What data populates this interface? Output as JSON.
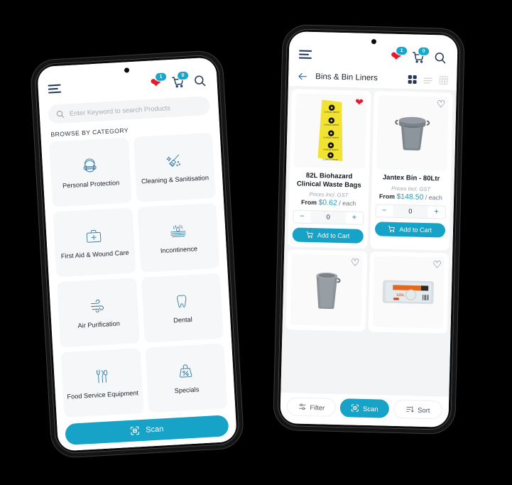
{
  "background_color": "#000000",
  "accent_color": "#16a3c7",
  "heart_color": "#e8192c",
  "navy_color": "#21365e",
  "left_phone": {
    "header": {
      "menu_icon": "hamburger-menu-icon",
      "wishlist_icon": "heart-icon",
      "wishlist_count": "1",
      "cart_icon": "cart-icon",
      "cart_count": "0",
      "search_icon": "search-icon"
    },
    "search": {
      "icon": "search-icon",
      "placeholder": "Enter Keyword to search Products",
      "value": ""
    },
    "section_title": "BROWSE BY CATEGORY",
    "categories": [
      {
        "label": "Personal Protection",
        "icon": "face-mask-icon"
      },
      {
        "label": "Cleaning & Sanitisation",
        "icon": "broom-sparkle-icon"
      },
      {
        "label": "First Aid & Wound Care",
        "icon": "first-aid-kit-icon"
      },
      {
        "label": "Incontinence",
        "icon": "absorbency-drops-icon"
      },
      {
        "label": "Air Purification",
        "icon": "air-flow-icon"
      },
      {
        "label": "Dental",
        "icon": "tooth-icon"
      },
      {
        "label": "Food Service Equipment",
        "icon": "cutlery-icon"
      },
      {
        "label": "Specials",
        "icon": "percent-tag-icon"
      }
    ],
    "scan_button": {
      "label": "Scan",
      "icon": "scan-icon"
    }
  },
  "right_phone": {
    "header": {
      "menu_icon": "hamburger-menu-icon",
      "wishlist_icon": "heart-icon",
      "wishlist_count": "1",
      "cart_icon": "cart-icon",
      "cart_count": "0",
      "search_icon": "search-icon"
    },
    "subheader": {
      "back_icon": "arrow-left-icon",
      "title": "Bins & Bin Liners",
      "views": [
        {
          "name": "grid-2x2-view",
          "active": true
        },
        {
          "name": "list-view",
          "active": false
        },
        {
          "name": "grid-3x3-view",
          "active": false
        }
      ]
    },
    "products": [
      {
        "name": "82L Biohazard Clinical Waste Bags",
        "image": "yellow-biohazard-waste-bag-roll",
        "favourited": true,
        "gst_note": "Prices Incl. GST",
        "price_prefix": "From",
        "price": "$0.62",
        "price_unit": "/ each",
        "quantity": "0",
        "decrement_label": "−",
        "increment_label": "+",
        "add_to_cart_label": "Add to Cart",
        "add_to_cart_icon": "cart-icon"
      },
      {
        "name": "Jantex Bin - 80Ltr",
        "image": "grey-plastic-bin-with-lid",
        "favourited": false,
        "gst_note": "Prices Incl. GST",
        "price_prefix": "From",
        "price": "$148.50",
        "price_unit": "/ each",
        "quantity": "0",
        "decrement_label": "−",
        "increment_label": "+",
        "add_to_cart_label": "Add to Cart",
        "add_to_cart_icon": "cart-icon"
      },
      {
        "name": "",
        "image": "grey-round-bin",
        "favourited": false
      },
      {
        "name": "",
        "image": "packaged-bin-liners-120l",
        "favourited": false
      }
    ],
    "bottom_bar": [
      {
        "label": "Filter",
        "icon": "filter-sliders-icon",
        "active": false
      },
      {
        "label": "Scan",
        "icon": "scan-icon",
        "active": true
      },
      {
        "label": "Sort",
        "icon": "sort-icon",
        "active": false
      }
    ]
  }
}
